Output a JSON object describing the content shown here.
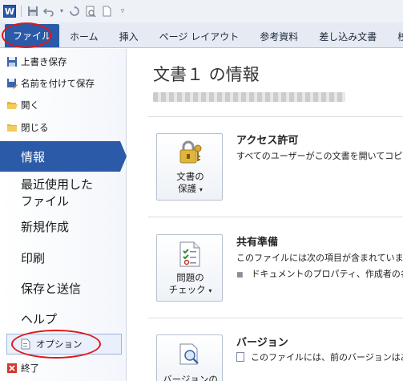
{
  "app": {
    "logo_letter": "W"
  },
  "qat": {
    "icons": [
      "save-icon",
      "undo-icon",
      "redo-icon",
      "print-preview-icon",
      "new-doc-icon",
      "customize-qat-icon"
    ]
  },
  "tabs": {
    "file": "ファイル",
    "items": [
      "ホーム",
      "挿入",
      "ページ レイアウト",
      "参考資料",
      "差し込み文書",
      "校閲"
    ]
  },
  "nav": {
    "save": "上書き保存",
    "save_as": "名前を付けて保存",
    "open": "開く",
    "close": "閉じる",
    "info": "情報",
    "recent_line1": "最近使用した",
    "recent_line2": "ファイル",
    "new": "新規作成",
    "print": "印刷",
    "save_send": "保存と送信",
    "help": "ヘルプ",
    "options": "オプション",
    "exit": "終了"
  },
  "main": {
    "title": "文書１ の情報",
    "protect": {
      "button_line1": "文書の",
      "button_line2": "保護",
      "title": "アクセス許可",
      "desc": "すべてのユーザーがこの文書を開いてコピ"
    },
    "inspect": {
      "button_line1": "問題の",
      "button_line2": "チェック",
      "title": "共有準備",
      "desc": "このファイルには次の項目が含まれていま",
      "bullet": "ドキュメントのプロパティ、作成者の名"
    },
    "versions": {
      "button_line1": "バージョンの",
      "title": "バージョン",
      "desc": "このファイルには、前のバージョンはあり"
    }
  },
  "colors": {
    "accent": "#2a5aa8",
    "annotation": "#e01818"
  }
}
